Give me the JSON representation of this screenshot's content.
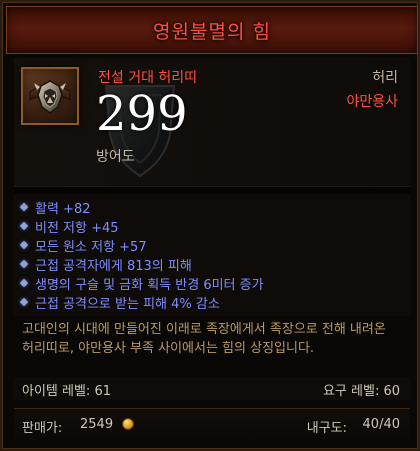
{
  "tooltip": {
    "title": "영원불멸의 힘",
    "item_name": "전설 거대 허리띠",
    "slot_type": "허리",
    "class_type": "야만용사",
    "armor_value": "299",
    "armor_label": "방어도",
    "affixes": [
      "활력 +82",
      "비전 저항 +45",
      "모든 원소 저항 +57",
      "근접 공격자에게 813의 피해",
      "생명의 구슬 및 금화 획득 반경 6미터 증가",
      "근접 공격으로 받는 피해 4% 감소"
    ],
    "lore": "고대인의 시대에 만들어진 이래로 족장에게서 족장으로 전해 내려온 허리띠로, 야만용사 부족 사이에서는 힘의 상징입니다.",
    "item_level": "아이템 레벨: 61",
    "required_level": "요구 레벨: 60",
    "price_label": "판매가:",
    "price_value": "2549",
    "durability_label": "내구도:",
    "durability_value": "40/40"
  },
  "icons": {
    "item": "belt-icon",
    "watermark": "shield-icon",
    "affix_bullet": "diamond-bullet-icon",
    "currency": "gold-coin-icon"
  },
  "colors": {
    "legendary": "#ff4e3f",
    "magic_affix": "#7f8dff",
    "lore": "#b99b60",
    "gold": "#d9a21b"
  }
}
